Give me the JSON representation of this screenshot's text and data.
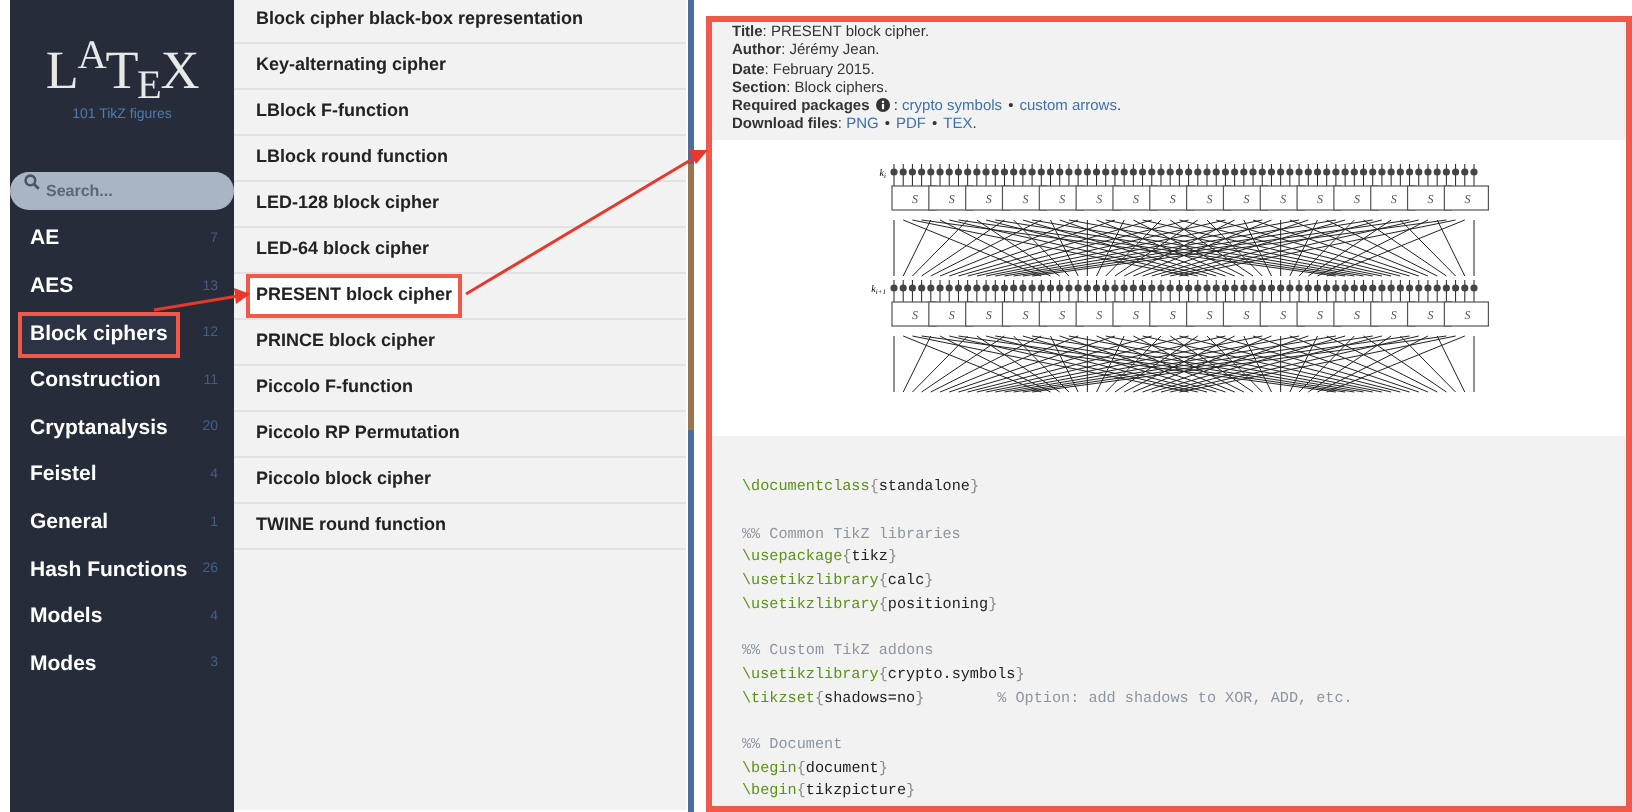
{
  "sidebar": {
    "logo": "L$^{A}$T$_{E}$X",
    "subtitle": "101 TikZ figures",
    "search": {
      "placeholder": "Search..."
    },
    "items": [
      {
        "label": "AE",
        "count": "7",
        "selected": false
      },
      {
        "label": "AES",
        "count": "13",
        "selected": false
      },
      {
        "label": "Block ciphers",
        "count": "12",
        "selected": true
      },
      {
        "label": "Construction",
        "count": "11",
        "selected": false
      },
      {
        "label": "Cryptanalysis",
        "count": "20",
        "selected": false
      },
      {
        "label": "Feistel",
        "count": "4",
        "selected": false
      },
      {
        "label": "General",
        "count": "1",
        "selected": false
      },
      {
        "label": "Hash Functions",
        "count": "26",
        "selected": false
      },
      {
        "label": "Models",
        "count": "4",
        "selected": false
      },
      {
        "label": "Modes",
        "count": "3",
        "selected": false
      }
    ]
  },
  "figures": [
    {
      "label": "Block cipher black-box representation",
      "selected": false
    },
    {
      "label": "Key-alternating cipher",
      "selected": false
    },
    {
      "label": "LBlock F-function",
      "selected": false
    },
    {
      "label": "LBlock round function",
      "selected": false
    },
    {
      "label": "LED-128 block cipher",
      "selected": false
    },
    {
      "label": "LED-64 block cipher",
      "selected": false
    },
    {
      "label": "PRESENT block cipher",
      "selected": true
    },
    {
      "label": "PRINCE block cipher",
      "selected": false
    },
    {
      "label": "Piccolo F-function",
      "selected": false
    },
    {
      "label": "Piccolo RP Permutation",
      "selected": false
    },
    {
      "label": "Piccolo block cipher",
      "selected": false
    },
    {
      "label": "TWINE round function",
      "selected": false
    }
  ],
  "details": {
    "info": [
      {
        "label": "Title",
        "value": ": PRESENT block cipher."
      },
      {
        "label": "Author",
        "value": ": Jérémy Jean."
      },
      {
        "label": "Date",
        "value": ": February 2015."
      },
      {
        "label": "Section",
        "value": ": Block ciphers."
      },
      {
        "label": "Required packages",
        "info_icon": true,
        "value": " : ",
        "links": [
          "crypto symbols",
          "custom arrows"
        ],
        "separator": "•",
        "end": "."
      },
      {
        "label": "Download files",
        "value": ": ",
        "links": [
          "PNG",
          "PDF",
          "TEX"
        ],
        "separator": "•",
        "end": "."
      }
    ],
    "figure": {
      "key_labels": [
        "k$_{i}$",
        "k$_{i+1}$"
      ],
      "sboxes": [
        [
          "S",
          "S",
          "S",
          "S",
          "S",
          "S",
          "S",
          "S",
          "S",
          "S",
          "S",
          "S",
          "S",
          "S",
          "S",
          "S"
        ],
        [
          "S",
          "S",
          "S",
          "S",
          "S",
          "S",
          "S",
          "S",
          "S",
          "S",
          "S",
          "S",
          "S",
          "S",
          "S",
          "S"
        ]
      ]
    },
    "code": [
      {
        "kind": "blank"
      },
      {
        "kind": "code",
        "tokens": [
          {
            "kind": "cmd",
            "text": "\\documentclass"
          },
          {
            "kind": "brace",
            "text": "{"
          },
          {
            "kind": "arg",
            "text": "standalone"
          },
          {
            "kind": "brace",
            "text": "}"
          }
        ]
      },
      {
        "kind": "blank"
      },
      {
        "kind": "code",
        "tokens": [
          {
            "kind": "comment",
            "text": "%% Common TikZ libraries"
          }
        ]
      },
      {
        "kind": "code",
        "tokens": [
          {
            "kind": "cmd",
            "text": "\\usepackage"
          },
          {
            "kind": "brace",
            "text": "{"
          },
          {
            "kind": "arg",
            "text": "tikz"
          },
          {
            "kind": "brace",
            "text": "}"
          }
        ]
      },
      {
        "kind": "code",
        "tokens": [
          {
            "kind": "cmd",
            "text": "\\usetikzlibrary"
          },
          {
            "kind": "brace",
            "text": "{"
          },
          {
            "kind": "arg",
            "text": "calc"
          },
          {
            "kind": "brace",
            "text": "}"
          }
        ]
      },
      {
        "kind": "code",
        "tokens": [
          {
            "kind": "cmd",
            "text": "\\usetikzlibrary"
          },
          {
            "kind": "brace",
            "text": "{"
          },
          {
            "kind": "arg",
            "text": "positioning"
          },
          {
            "kind": "brace",
            "text": "}"
          }
        ]
      },
      {
        "kind": "blank"
      },
      {
        "kind": "code",
        "tokens": [
          {
            "kind": "comment",
            "text": "%% Custom TikZ addons"
          }
        ]
      },
      {
        "kind": "code",
        "tokens": [
          {
            "kind": "cmd",
            "text": "\\usetikzlibrary"
          },
          {
            "kind": "brace",
            "text": "{"
          },
          {
            "kind": "arg",
            "text": "crypto.symbols"
          },
          {
            "kind": "brace",
            "text": "}"
          }
        ]
      },
      {
        "kind": "code",
        "tokens": [
          {
            "kind": "cmd",
            "text": "\\tikzset"
          },
          {
            "kind": "brace",
            "text": "{"
          },
          {
            "kind": "arg",
            "text": "shadows=no"
          },
          {
            "kind": "brace",
            "text": "}"
          },
          {
            "kind": "comment",
            "text": "        % Option: add shadows to XOR, ADD, etc."
          }
        ]
      },
      {
        "kind": "blank"
      },
      {
        "kind": "code",
        "tokens": [
          {
            "kind": "comment",
            "text": "%% Document"
          }
        ]
      },
      {
        "kind": "code",
        "tokens": [
          {
            "kind": "cmd",
            "text": "\\begin"
          },
          {
            "kind": "brace",
            "text": "{"
          },
          {
            "kind": "arg",
            "text": "document"
          },
          {
            "kind": "brace",
            "text": "}"
          }
        ]
      },
      {
        "kind": "code",
        "tokens": [
          {
            "kind": "cmd",
            "text": "\\begin"
          },
          {
            "kind": "brace",
            "text": "{"
          },
          {
            "kind": "arg",
            "text": "tikzpicture"
          },
          {
            "kind": "brace",
            "text": "}"
          }
        ]
      }
    ]
  }
}
